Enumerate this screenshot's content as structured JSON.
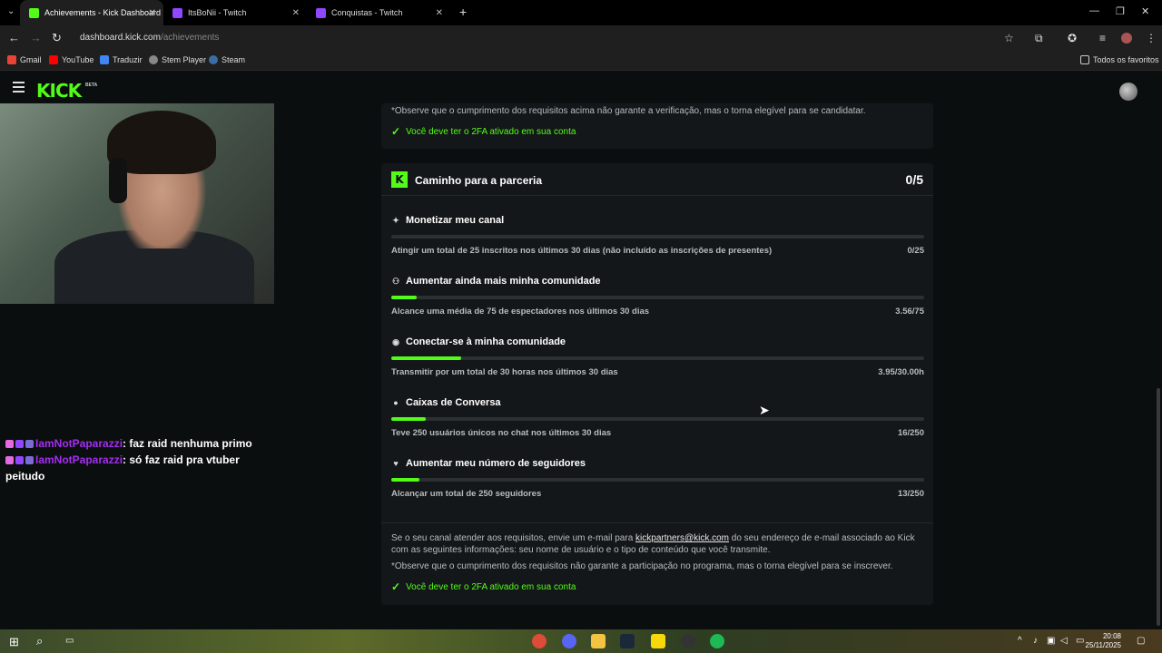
{
  "browser": {
    "tabs": [
      {
        "title": "Achievements - Kick Dashboard",
        "active": true,
        "favicon_color": "#53fc18"
      },
      {
        "title": "ItsBoNii - Twitch",
        "active": false,
        "favicon_color": "#9146ff"
      },
      {
        "title": "Conquistas - Twitch",
        "active": false,
        "favicon_color": "#9146ff"
      }
    ],
    "url_host": "dashboard.kick.com",
    "url_path": "/achievements",
    "bookmarks": [
      {
        "label": "Gmail",
        "color": "#ea4335"
      },
      {
        "label": "YouTube",
        "color": "#ff0000"
      },
      {
        "label": "Traduzir",
        "color": "#4285f4"
      },
      {
        "label": "Stem Player",
        "color": "#888888"
      },
      {
        "label": "Steam",
        "color": "#1b2838"
      }
    ],
    "all_bookmarks_label": "Todos os favoritos"
  },
  "kick": {
    "logo": "KICK",
    "beta": "BETA"
  },
  "chat": [
    {
      "user": "IamNotPaparazzi",
      "message": "faz raid nenhuma primo"
    },
    {
      "user": "IamNotPaparazzi",
      "message": "só faz raid pra vtuber peitudo"
    }
  ],
  "verification_card": {
    "note": "*Observe que o cumprimento dos requisitos acima não garante a verificação, mas o torna elegível para se candidatar.",
    "twofa": "Você deve ter o 2FA ativado em sua conta"
  },
  "partner_card": {
    "icon_letter": "K",
    "title": "Caminho para a parceria",
    "score": "0/5",
    "requirements": [
      {
        "icon": "sparkle-icon",
        "glyph": "✦",
        "title": "Monetizar meu canal",
        "desc": "Atingir um total de 25 inscritos nos últimos 30 dias (não incluído as inscrições de presentes)",
        "value": "0/25",
        "progress": 0.0
      },
      {
        "icon": "community-icon",
        "glyph": "⚇",
        "title": "Aumentar ainda mais minha comunidade",
        "desc": "Alcance uma média de 75 de espectadores nos últimos 30 dias",
        "value": "3.56/75",
        "progress": 0.047
      },
      {
        "icon": "broadcast-icon",
        "glyph": "◉",
        "title": "Conectar-se à minha comunidade",
        "desc": "Transmitir por um total de 30 horas nos últimos 30 dias",
        "value": "3.95/30.00h",
        "progress": 0.132
      },
      {
        "icon": "chat-bubble-icon",
        "glyph": "●",
        "title": "Caixas de Conversa",
        "desc": "Teve 250 usuários únicos no chat nos últimos 30 dias",
        "value": "16/250",
        "progress": 0.064
      },
      {
        "icon": "heart-icon",
        "glyph": "♥",
        "title": "Aumentar meu número de seguidores",
        "desc": "Alcançar um total de 250 seguidores",
        "value": "13/250",
        "progress": 0.052
      }
    ],
    "info_prefix": "Se o seu canal atender aos requisitos, envie um e-mail para ",
    "info_email": "kickpartners@kick.com",
    "info_suffix": " do seu endereço de e-mail associado ao Kick com as seguintes informações: seu nome de usuário e o tipo de conteúdo que você transmite.",
    "note": "*Observe que o cumprimento dos requisitos não garante a participação no programa, mas o torna elegível para se inscrever.",
    "twofa": "Você deve ter o 2FA ativado em sua conta"
  },
  "taskbar": {
    "time": "20:08",
    "date": "25/11/2025"
  }
}
